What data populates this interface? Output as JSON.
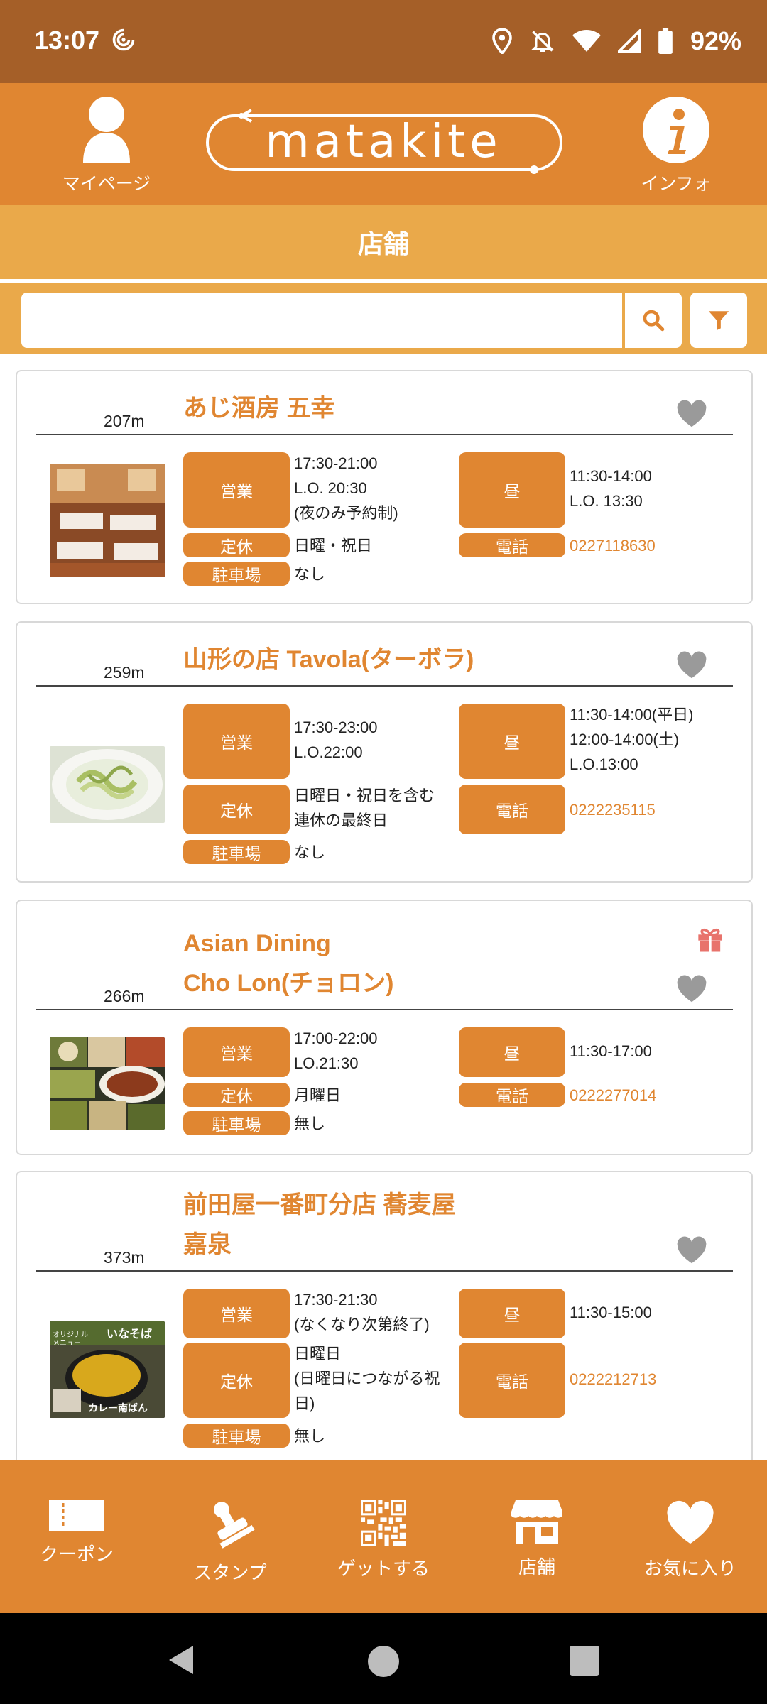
{
  "status": {
    "time": "13:07",
    "battery": "92%"
  },
  "header": {
    "mypage_label": "マイページ",
    "logo_text": "matakite",
    "info_label": "インフォ"
  },
  "page": {
    "title": "店舗"
  },
  "search": {
    "placeholder": "",
    "value": ""
  },
  "labels": {
    "open": "営業",
    "lunch": "昼",
    "closed": "定休",
    "tel": "電話",
    "parking": "駐車場"
  },
  "shops": [
    {
      "distance": "207m",
      "name": "あじ酒房 五幸",
      "hours": "17:30-21:00\nL.O. 20:30\n(夜のみ予約制)",
      "lunch": "11:30-14:00\nL.O. 13:30",
      "closed": "日曜・祝日",
      "tel": "0227118630",
      "parking": "なし"
    },
    {
      "distance": "259m",
      "name": "山形の店 Tavola(ターボラ)",
      "hours": "17:30-23:00\nL.O.22:00",
      "lunch": "11:30-14:00(平日)\n12:00-14:00(土)\nL.O.13:00",
      "closed": "日曜日・祝日を含む\n連休の最終日",
      "tel": "0222235115",
      "parking": "なし"
    },
    {
      "distance": "266m",
      "name": "Asian Dining\nCho Lon(チョロン)",
      "hours": "17:00-22:00\nLO.21:30",
      "lunch": "11:30-17:00",
      "closed": "月曜日",
      "tel": "0222277014",
      "parking": "無し"
    },
    {
      "distance": "373m",
      "name": "前田屋一番町分店 蕎麦屋\n嘉泉",
      "hours": "17:30-21:30\n(なくなり次第終了)",
      "lunch": "11:30-15:00",
      "closed": "日曜日\n(日曜日につながる祝\n日)",
      "tel": "0222212713",
      "parking": "無し"
    }
  ],
  "photo_text": {
    "orig_menu": "オリジナル\nメニュー",
    "inasoba": "いなそば",
    "curry": "カレー南ばん"
  },
  "nav": {
    "coupon": "クーポン",
    "stamp": "スタンプ",
    "get": "ゲットする",
    "shop": "店舗",
    "favorites": "お気に入り"
  },
  "colors": {
    "brand": "#e08631",
    "title_bar": "#eaa94a",
    "status_bar": "#a55f28",
    "heart": "#9a9a9a",
    "gift": "#e8736c"
  }
}
